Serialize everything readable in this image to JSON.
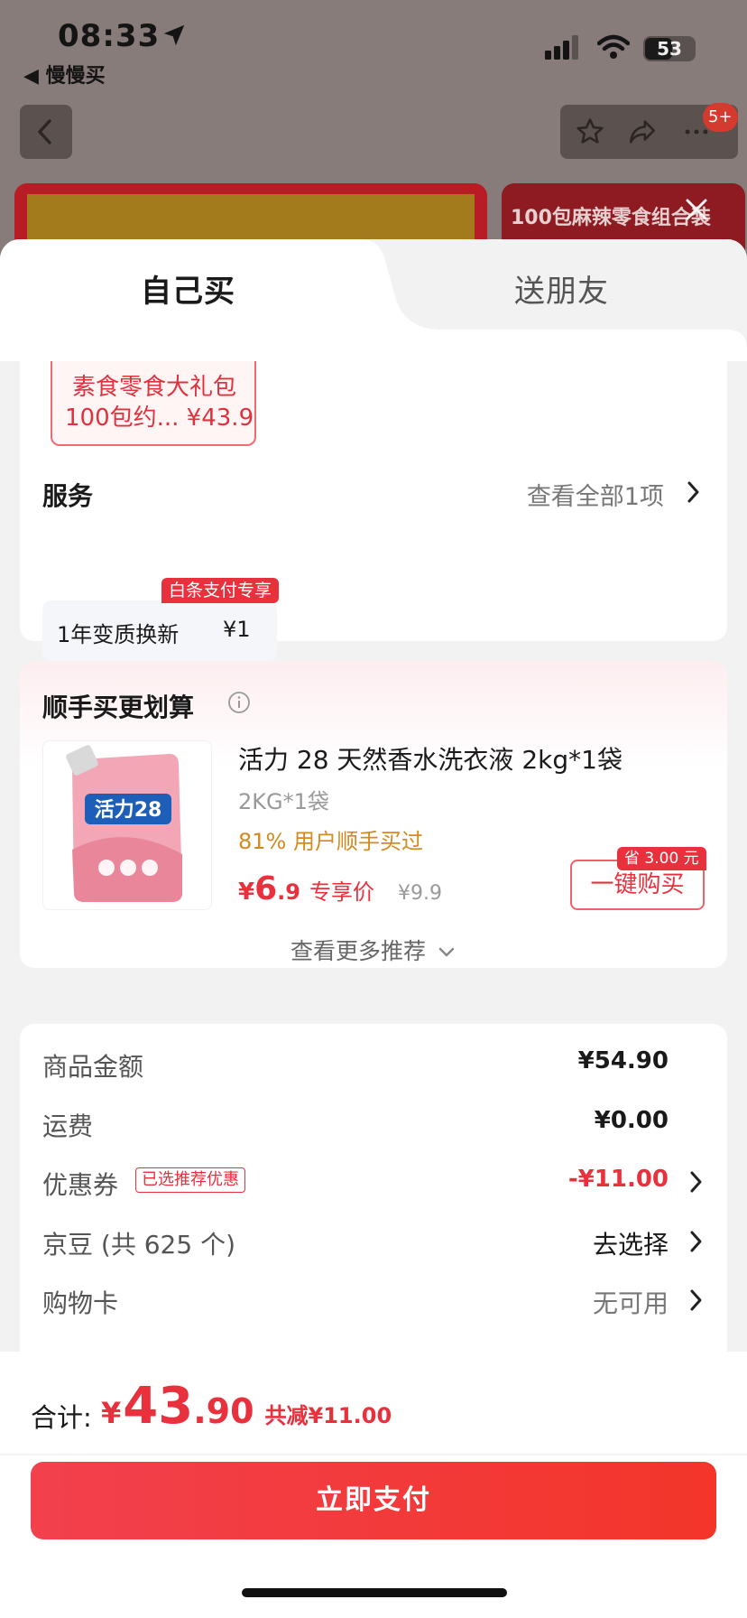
{
  "status_bar": {
    "time": "08:33",
    "back_app": "◀ 慢慢买",
    "battery": "53"
  },
  "nav": {
    "badge": "5+"
  },
  "background": {
    "banner_right_text": "100包麻辣零食组合装"
  },
  "tabs": [
    {
      "label": "自己买",
      "active": true
    },
    {
      "label": "送朋友",
      "active": false
    }
  ],
  "gift": {
    "line1": "素食零食大礼包",
    "line2": "100包约... ¥43.9"
  },
  "service": {
    "title": "服务",
    "link": "查看全部1项",
    "item_name": "1年变质换新",
    "item_price": "¥1",
    "item_badge": "白条支付专享"
  },
  "recommend": {
    "title": "顺手买更划算",
    "product_name": "活力 28 天然香水洗衣液 2kg*1袋",
    "product_spec": "2KG*1袋",
    "product_bought": "81% 用户顺手买过",
    "price_yen": "¥",
    "price_int": "6",
    "price_dec": ".9",
    "price_tag": "专享价",
    "price_orig": "¥9.9",
    "buy_label": "一键购买",
    "save_badge": "省 3.00 元",
    "more_label": "查看更多推荐",
    "product_logo": "活力28"
  },
  "summary": {
    "rows": [
      {
        "label": "商品金额",
        "value": "¥54.90"
      },
      {
        "label": "运费",
        "value": "¥0.00"
      },
      {
        "label": "优惠券",
        "badge": "已选推荐优惠",
        "value": "-¥11.00"
      },
      {
        "label": "京豆 (共 625 个)",
        "value": "去选择"
      },
      {
        "label": "购物卡",
        "value": "无可用"
      }
    ]
  },
  "footer": {
    "total_label": "合计:",
    "total_yen": "¥",
    "total_int": "43",
    "total_dec": ".90",
    "total_saved": "共减¥11.00",
    "pay_label": "立即支付"
  },
  "colors": {
    "accent_red": "#e8313d",
    "orange_text": "#d38a1e"
  }
}
